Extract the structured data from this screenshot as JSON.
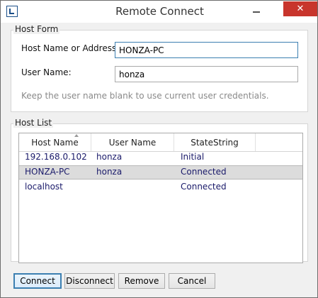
{
  "window": {
    "title": "Remote Connect",
    "close_glyph": "✕"
  },
  "host_form": {
    "group_label": "Host Form",
    "host_label": "Host Name or Address:",
    "host_value": "HONZA-PC",
    "user_label": "User Name:",
    "user_value": "honza",
    "hint": "Keep the user name blank to use current user credentials."
  },
  "host_list": {
    "group_label": "Host List",
    "columns": [
      "Host Name",
      "User Name",
      "StateString"
    ],
    "sort_column": "Host Name",
    "rows": [
      {
        "host": "192.168.0.102",
        "user": "honza",
        "state": "Initial",
        "selected": false
      },
      {
        "host": "HONZA-PC",
        "user": "honza",
        "state": "Connected",
        "selected": true
      },
      {
        "host": "localhost",
        "user": "",
        "state": "Connected",
        "selected": false
      }
    ]
  },
  "buttons": {
    "connect": "Connect",
    "disconnect": "Disconnect",
    "remove": "Remove",
    "cancel": "Cancel"
  },
  "colors": {
    "accent": "#3c7fb1",
    "close": "#c8352c",
    "row_text": "#1a1a6a",
    "selected_row": "#dcdcdc"
  }
}
